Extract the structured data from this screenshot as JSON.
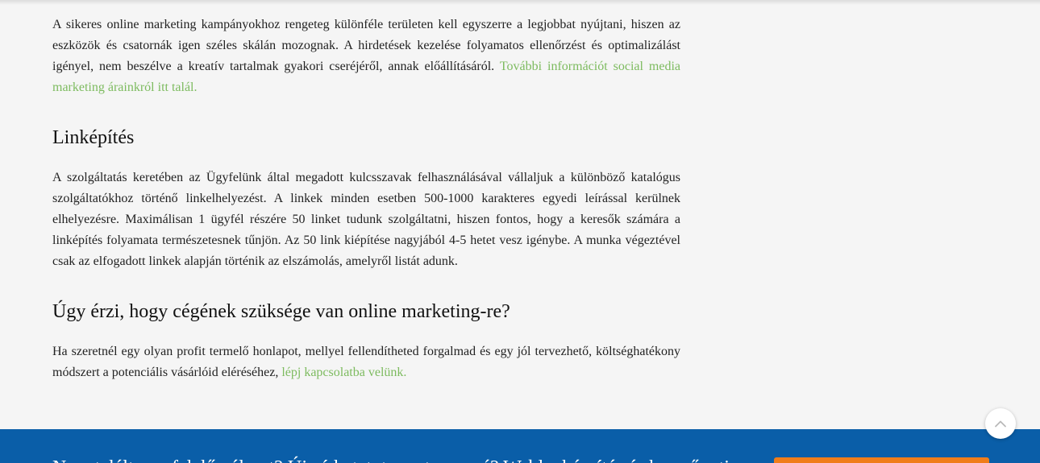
{
  "content": {
    "paragraph_1": {
      "text": "A sikeres online marketing kampányokhoz rengeteg különféle területen kell egyszerre a legjobbat nyújtani, hiszen az eszközök és csatornák igen széles skálán mozognak. A hirdetések kezelése folyamatos ellenőrzést és optimalizálást igényel, nem beszélve a kreatív tartalmak gyakori cseréjéről, annak előállításáról. ",
      "link": "További információt social media marketing árainkról itt talál."
    },
    "heading_linkepites": "Linképítés",
    "paragraph_2": "A szolgáltatás keretében az Ügyfelünk által megadott kulcsszavak felhasználásával vállaljuk a különböző katalógus szolgáltatókhoz történő linkelhelyezést. A linkek minden esetben 500-1000 karakteres egyedi leírással kerülnek elhelyezésre. Maximálisan 1 ügyfél részére 50 linket tudunk szolgáltatni, hiszen fontos, hogy a keresők számára a linképítés folyamata természetesnek tűnjön. Az 50 link kiépítése nagyjából 4-5 hetet vesz igénybe. A munka végeztével csak az elfogadott linkek alapján történik az elszámolás, amelyről listát adunk.",
    "heading_question": "Úgy érzi, hogy cégének szüksége van online marketing-re?",
    "paragraph_3": {
      "text": "Ha szeretnél egy olyan profit termelő honlapot, mellyel fellendítheted forgalmad és egy jól tervezhető, költséghatékony módszert a potenciális vásárlóid eléréséhez, ",
      "link": "lépj kapcsolatba velünk."
    }
  },
  "footer": {
    "text": "Nem talált megfelelő választ? Újraírhatatot megtervezné? Weblapkészítés és keresőoptimalizálás",
    "cta_label": ""
  },
  "colors": {
    "link": "#7dbb5f",
    "footer_band": "#0a5ea8",
    "cta": "#f07d1a"
  },
  "icons": {
    "scroll_top": "chevron-up-icon"
  }
}
